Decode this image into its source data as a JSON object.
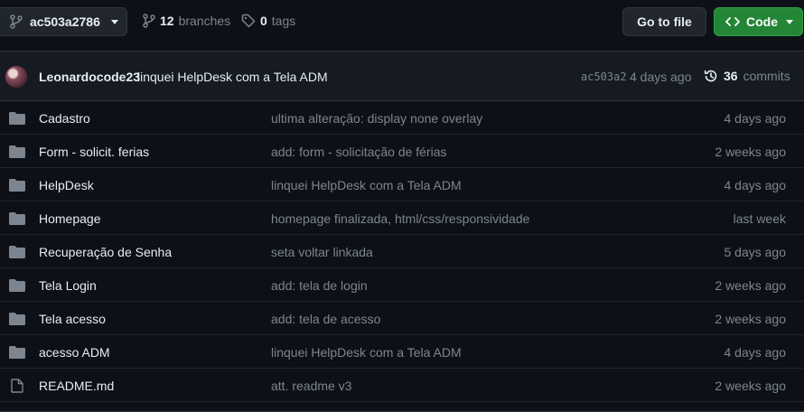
{
  "toolbar": {
    "branch_name": "ac503a2786",
    "branches_count": "12",
    "branches_label": "branches",
    "tags_count": "0",
    "tags_label": "tags",
    "goto_file_label": "Go to file",
    "code_label": "Code"
  },
  "latest_commit": {
    "author": "Leonardocode23",
    "message": "linquei HelpDesk com a Tela ADM",
    "sha": "ac503a2",
    "time": "4 days ago",
    "commits_count": "36",
    "commits_label": "commits"
  },
  "files": [
    {
      "name": "Cadastro",
      "type": "folder",
      "message": "ultima alteração: display none overlay",
      "age": "4 days ago"
    },
    {
      "name": "Form - solicit. ferias",
      "type": "folder",
      "message": "add: form - solicitação de férias",
      "age": "2 weeks ago"
    },
    {
      "name": "HelpDesk",
      "type": "folder",
      "message": "linquei HelpDesk com a Tela ADM",
      "age": "4 days ago"
    },
    {
      "name": "Homepage",
      "type": "folder",
      "message": "homepage finalizada, html/css/responsividade",
      "age": "last week"
    },
    {
      "name": "Recuperação de Senha",
      "type": "folder",
      "message": "seta voltar linkada",
      "age": "5 days ago"
    },
    {
      "name": "Tela Login",
      "type": "folder",
      "message": "add: tela de login",
      "age": "2 weeks ago"
    },
    {
      "name": "Tela acesso",
      "type": "folder",
      "message": "add: tela de acesso",
      "age": "2 weeks ago"
    },
    {
      "name": "acesso ADM",
      "type": "folder",
      "message": "linquei HelpDesk com a Tela ADM",
      "age": "4 days ago"
    },
    {
      "name": "README.md",
      "type": "file",
      "message": "att. readme v3",
      "age": "2 weeks ago"
    }
  ],
  "colors": {
    "background": "#0d1117",
    "header_bg": "#161b22",
    "border": "#30363d",
    "muted_text": "#7d8590",
    "primary_text": "#e6edf3",
    "code_button": "#238636",
    "folder_icon": "#7d8590"
  }
}
